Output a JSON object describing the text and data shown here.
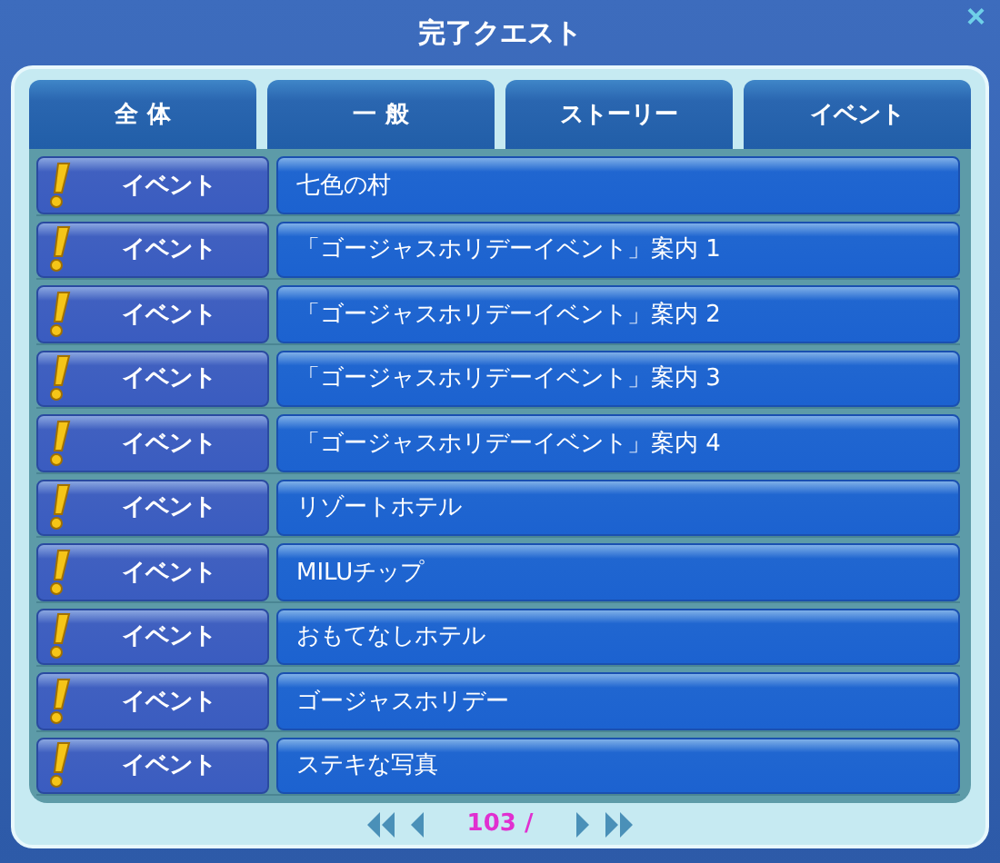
{
  "window": {
    "title": "完了クエスト",
    "close": "×"
  },
  "tabs": [
    {
      "label": "全 体"
    },
    {
      "label": "一 般"
    },
    {
      "label": "ストーリー"
    },
    {
      "label": "イベント"
    }
  ],
  "quests": [
    {
      "category": "イベント",
      "title": "七色の村"
    },
    {
      "category": "イベント",
      "title": "「ゴージャスホリデーイベント」案内 1"
    },
    {
      "category": "イベント",
      "title": "「ゴージャスホリデーイベント」案内 2"
    },
    {
      "category": "イベント",
      "title": "「ゴージャスホリデーイベント」案内 3"
    },
    {
      "category": "イベント",
      "title": "「ゴージャスホリデーイベント」案内 4"
    },
    {
      "category": "イベント",
      "title": "リゾートホテル"
    },
    {
      "category": "イベント",
      "title": "MILUチップ"
    },
    {
      "category": "イベント",
      "title": "おもてなしホテル"
    },
    {
      "category": "イベント",
      "title": "ゴージャスホリデー"
    },
    {
      "category": "イベント",
      "title": "ステキな写真"
    }
  ],
  "pager": {
    "page": "103 /"
  }
}
